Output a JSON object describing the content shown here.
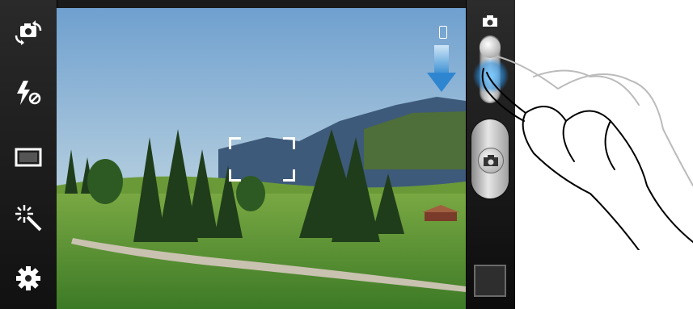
{
  "toolbar": {
    "items": [
      {
        "name": "switch-camera",
        "icon": "switch-camera-icon"
      },
      {
        "name": "flash-off",
        "icon": "flash-off-icon"
      },
      {
        "name": "shooting-mode",
        "icon": "frame-icon"
      },
      {
        "name": "scene-effects",
        "icon": "magic-wand-icon"
      },
      {
        "name": "settings",
        "icon": "gear-icon"
      }
    ]
  },
  "mode_switch": {
    "current": "camera",
    "camera_icon": "camera-icon"
  },
  "colors": {
    "accent": "#2f86d0",
    "glow": "#78c8ff",
    "bar": "#1a1a1a"
  }
}
